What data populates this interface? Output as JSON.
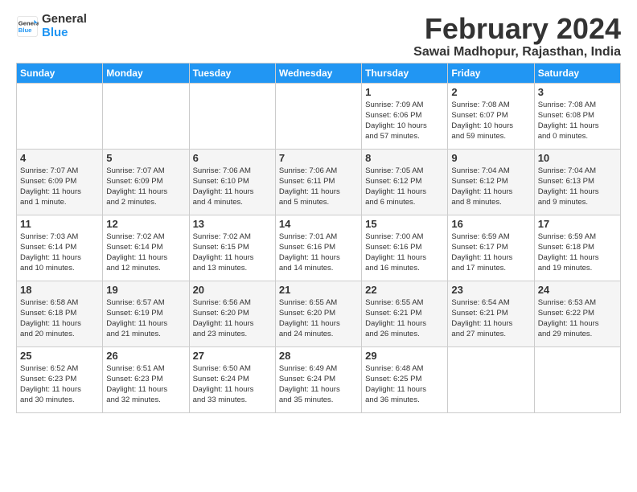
{
  "header": {
    "logo_line1": "General",
    "logo_line2": "Blue",
    "title": "February 2024",
    "subtitle": "Sawai Madhopur, Rajasthan, India"
  },
  "days_of_week": [
    "Sunday",
    "Monday",
    "Tuesday",
    "Wednesday",
    "Thursday",
    "Friday",
    "Saturday"
  ],
  "weeks": [
    [
      {
        "day": "",
        "info": ""
      },
      {
        "day": "",
        "info": ""
      },
      {
        "day": "",
        "info": ""
      },
      {
        "day": "",
        "info": ""
      },
      {
        "day": "1",
        "info": "Sunrise: 7:09 AM\nSunset: 6:06 PM\nDaylight: 10 hours\nand 57 minutes."
      },
      {
        "day": "2",
        "info": "Sunrise: 7:08 AM\nSunset: 6:07 PM\nDaylight: 10 hours\nand 59 minutes."
      },
      {
        "day": "3",
        "info": "Sunrise: 7:08 AM\nSunset: 6:08 PM\nDaylight: 11 hours\nand 0 minutes."
      }
    ],
    [
      {
        "day": "4",
        "info": "Sunrise: 7:07 AM\nSunset: 6:09 PM\nDaylight: 11 hours\nand 1 minute."
      },
      {
        "day": "5",
        "info": "Sunrise: 7:07 AM\nSunset: 6:09 PM\nDaylight: 11 hours\nand 2 minutes."
      },
      {
        "day": "6",
        "info": "Sunrise: 7:06 AM\nSunset: 6:10 PM\nDaylight: 11 hours\nand 4 minutes."
      },
      {
        "day": "7",
        "info": "Sunrise: 7:06 AM\nSunset: 6:11 PM\nDaylight: 11 hours\nand 5 minutes."
      },
      {
        "day": "8",
        "info": "Sunrise: 7:05 AM\nSunset: 6:12 PM\nDaylight: 11 hours\nand 6 minutes."
      },
      {
        "day": "9",
        "info": "Sunrise: 7:04 AM\nSunset: 6:12 PM\nDaylight: 11 hours\nand 8 minutes."
      },
      {
        "day": "10",
        "info": "Sunrise: 7:04 AM\nSunset: 6:13 PM\nDaylight: 11 hours\nand 9 minutes."
      }
    ],
    [
      {
        "day": "11",
        "info": "Sunrise: 7:03 AM\nSunset: 6:14 PM\nDaylight: 11 hours\nand 10 minutes."
      },
      {
        "day": "12",
        "info": "Sunrise: 7:02 AM\nSunset: 6:14 PM\nDaylight: 11 hours\nand 12 minutes."
      },
      {
        "day": "13",
        "info": "Sunrise: 7:02 AM\nSunset: 6:15 PM\nDaylight: 11 hours\nand 13 minutes."
      },
      {
        "day": "14",
        "info": "Sunrise: 7:01 AM\nSunset: 6:16 PM\nDaylight: 11 hours\nand 14 minutes."
      },
      {
        "day": "15",
        "info": "Sunrise: 7:00 AM\nSunset: 6:16 PM\nDaylight: 11 hours\nand 16 minutes."
      },
      {
        "day": "16",
        "info": "Sunrise: 6:59 AM\nSunset: 6:17 PM\nDaylight: 11 hours\nand 17 minutes."
      },
      {
        "day": "17",
        "info": "Sunrise: 6:59 AM\nSunset: 6:18 PM\nDaylight: 11 hours\nand 19 minutes."
      }
    ],
    [
      {
        "day": "18",
        "info": "Sunrise: 6:58 AM\nSunset: 6:18 PM\nDaylight: 11 hours\nand 20 minutes."
      },
      {
        "day": "19",
        "info": "Sunrise: 6:57 AM\nSunset: 6:19 PM\nDaylight: 11 hours\nand 21 minutes."
      },
      {
        "day": "20",
        "info": "Sunrise: 6:56 AM\nSunset: 6:20 PM\nDaylight: 11 hours\nand 23 minutes."
      },
      {
        "day": "21",
        "info": "Sunrise: 6:55 AM\nSunset: 6:20 PM\nDaylight: 11 hours\nand 24 minutes."
      },
      {
        "day": "22",
        "info": "Sunrise: 6:55 AM\nSunset: 6:21 PM\nDaylight: 11 hours\nand 26 minutes."
      },
      {
        "day": "23",
        "info": "Sunrise: 6:54 AM\nSunset: 6:21 PM\nDaylight: 11 hours\nand 27 minutes."
      },
      {
        "day": "24",
        "info": "Sunrise: 6:53 AM\nSunset: 6:22 PM\nDaylight: 11 hours\nand 29 minutes."
      }
    ],
    [
      {
        "day": "25",
        "info": "Sunrise: 6:52 AM\nSunset: 6:23 PM\nDaylight: 11 hours\nand 30 minutes."
      },
      {
        "day": "26",
        "info": "Sunrise: 6:51 AM\nSunset: 6:23 PM\nDaylight: 11 hours\nand 32 minutes."
      },
      {
        "day": "27",
        "info": "Sunrise: 6:50 AM\nSunset: 6:24 PM\nDaylight: 11 hours\nand 33 minutes."
      },
      {
        "day": "28",
        "info": "Sunrise: 6:49 AM\nSunset: 6:24 PM\nDaylight: 11 hours\nand 35 minutes."
      },
      {
        "day": "29",
        "info": "Sunrise: 6:48 AM\nSunset: 6:25 PM\nDaylight: 11 hours\nand 36 minutes."
      },
      {
        "day": "",
        "info": ""
      },
      {
        "day": "",
        "info": ""
      }
    ]
  ]
}
